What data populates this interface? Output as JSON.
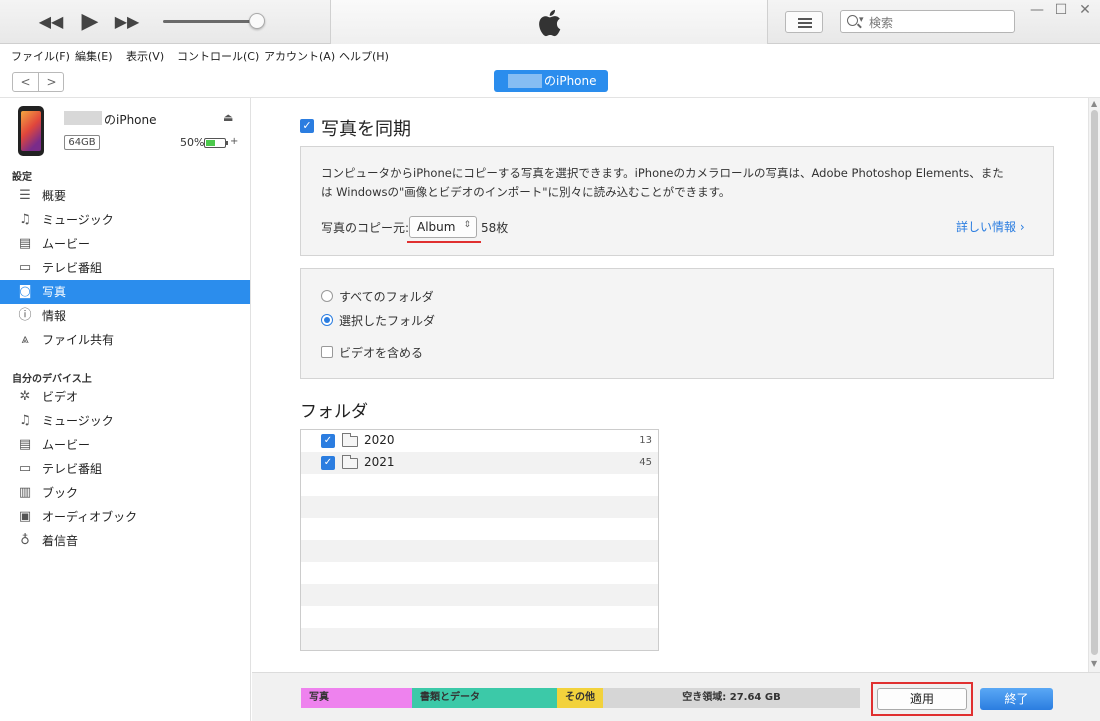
{
  "search": {
    "placeholder": "検索"
  },
  "menu": [
    "ファイル(F)",
    "編集(E)",
    "表示(V)",
    "コントロール(C)",
    "アカウント(A)",
    "ヘルプ(H)"
  ],
  "nav": {
    "back": "<",
    "forward": ">"
  },
  "device": {
    "pill_label": "のiPhone",
    "name": "のiPhone",
    "capacity": "64GB",
    "battery_percent_text": "50%",
    "battery_level": 0.5
  },
  "sidebar": {
    "settings_header": "設定",
    "settings_items": [
      {
        "label": "概要",
        "icon": "list-icon"
      },
      {
        "label": "ミュージック",
        "icon": "music-note-icon"
      },
      {
        "label": "ムービー",
        "icon": "film-icon"
      },
      {
        "label": "テレビ番組",
        "icon": "tv-icon"
      },
      {
        "label": "写真",
        "icon": "camera-icon",
        "selected": true
      },
      {
        "label": "情報",
        "icon": "info-icon"
      },
      {
        "label": "ファイル共有",
        "icon": "apps-icon"
      }
    ],
    "devices_header": "自分のデバイス上",
    "device_items": [
      {
        "label": "ビデオ",
        "icon": "gear-icon"
      },
      {
        "label": "ミュージック",
        "icon": "music-note-icon"
      },
      {
        "label": "ムービー",
        "icon": "film-icon"
      },
      {
        "label": "テレビ番組",
        "icon": "tv-icon"
      },
      {
        "label": "ブック",
        "icon": "book-icon"
      },
      {
        "label": "オーディオブック",
        "icon": "audiobook-icon"
      },
      {
        "label": "着信音",
        "icon": "bell-icon"
      }
    ]
  },
  "main": {
    "sync_title": "写真を同期",
    "description": "コンピュータからiPhoneにコピーする写真を選択できます。iPhoneのカメラロールの写真は、Adobe Photoshop Elements、または Windowsの\"画像とビデオのインポート\"に別々に読み込むことができます。",
    "copy_from_label": "写真のコピー元:",
    "copy_from_value": "Album",
    "photo_count": "58枚",
    "more_info": "詳しい情報 ›",
    "options": {
      "all_folders": "すべてのフォルダ",
      "selected_folders": "選択したフォルダ",
      "include_videos": "ビデオを含める"
    },
    "folder_header": "フォルダ",
    "folders": [
      {
        "name": "2020",
        "count": "13"
      },
      {
        "name": "2021",
        "count": "45"
      }
    ]
  },
  "capacity_bar": {
    "photos": "写真",
    "documents": "書類とデータ",
    "other": "その他",
    "free": "空き領域: 27.64 GB",
    "colors": {
      "photos": "#ee82ee",
      "documents": "#3cc9a8",
      "other": "#f2d23c",
      "free": "#d6d6d6"
    }
  },
  "buttons": {
    "apply": "適用",
    "done": "終了"
  }
}
